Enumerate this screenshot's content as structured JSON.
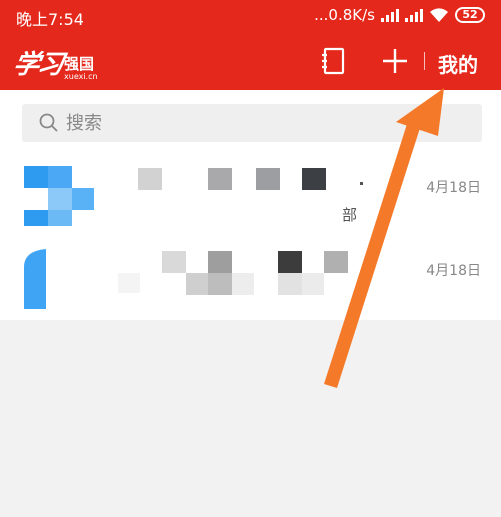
{
  "status_bar": {
    "time": "晚上7:54",
    "network_speed": "...0.8K/s",
    "battery": "52"
  },
  "header": {
    "logo_script": "学习",
    "logo_main": "强国",
    "logo_sub": "xuexi.cn",
    "mine_label": "我的",
    "book_icon": "address-book-icon",
    "plus_icon": "plus-icon",
    "accent_color": "#e4281c"
  },
  "search": {
    "placeholder": "搜索"
  },
  "conversations": [
    {
      "date": "4月18日",
      "snippet": "部"
    },
    {
      "date": "4月18日"
    }
  ],
  "annotation": {
    "arrow_color": "#f47a2a"
  }
}
